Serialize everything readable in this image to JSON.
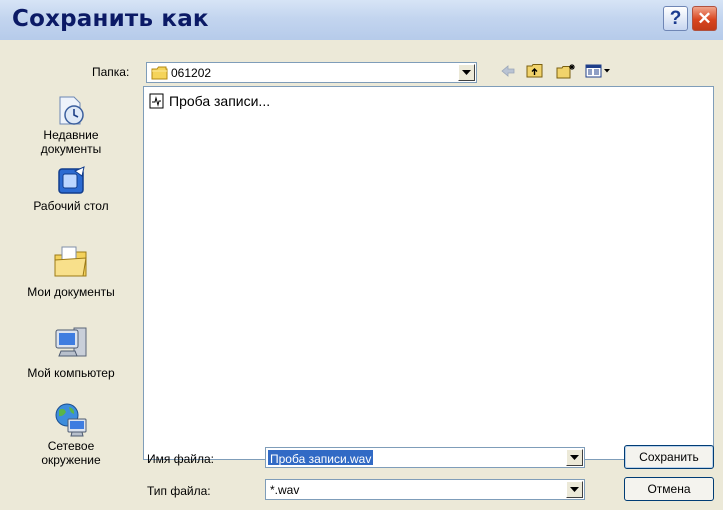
{
  "window": {
    "title": "Сохранить как",
    "help_glyph": "?",
    "close_glyph": "✕"
  },
  "folder": {
    "label": "Папка:",
    "value": "061202",
    "icon": "folder-icon"
  },
  "toolbar": {
    "icons": [
      "back-arrow-icon",
      "up-folder-icon",
      "new-folder-icon",
      "view-menu-icon"
    ]
  },
  "places": [
    {
      "label_line1": "Недавние",
      "label_line2": "документы",
      "icon": "recent-documents-icon"
    },
    {
      "label_line1": "Рабочий стол",
      "label_line2": "",
      "icon": "desktop-icon"
    },
    {
      "label_line1": "Мои документы",
      "label_line2": "",
      "icon": "my-documents-icon"
    },
    {
      "label_line1": "Мой компьютер",
      "label_line2": "",
      "icon": "my-computer-icon"
    },
    {
      "label_line1": "Сетевое",
      "label_line2": "окружение",
      "icon": "network-places-icon"
    }
  ],
  "files": [
    {
      "name": "Проба записи...",
      "icon": "sound-file-icon"
    }
  ],
  "filename": {
    "label": "Имя файла:",
    "value": "Проба записи.wav"
  },
  "filetype": {
    "label": "Тип файла:",
    "value": "*.wav"
  },
  "buttons": {
    "save": "Сохранить",
    "cancel": "Отмена"
  },
  "colors": {
    "titlebar": "#c3d5ef",
    "title_text": "#0b1a66",
    "dialog_bg": "#ece9d8",
    "close_button": "#d9451f",
    "selection": "#316ac5"
  }
}
